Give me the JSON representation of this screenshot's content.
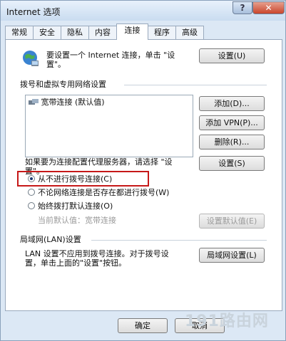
{
  "window": {
    "title": "Internet 选项",
    "help": "?",
    "close": "✕"
  },
  "tabs": [
    {
      "label": "常规"
    },
    {
      "label": "安全"
    },
    {
      "label": "隐私"
    },
    {
      "label": "内容"
    },
    {
      "label": "连接"
    },
    {
      "label": "程序"
    },
    {
      "label": "高级"
    }
  ],
  "setup": {
    "text_line1": "要设置一个 Internet 连接，单击 \"设",
    "text_line2": "置\"。",
    "button": "设置(U)"
  },
  "dialup": {
    "header": "拨号和虚拟专用网络设置",
    "list_item": "宽带连接 (默认值)",
    "add": "添加(D)...",
    "add_vpn": "添加 VPN(P)...",
    "remove": "删除(R)...",
    "settings": "设置(S)",
    "proxy_text_line1": "如果要为连接配置代理服务器，请选择 \"设",
    "proxy_text_line2": "置\"。",
    "radio1": "从不进行拨号连接(C)",
    "radio2": "不论网络连接是否存在都进行拨号(W)",
    "radio3": "始终拨打默认连接(O)",
    "current_default": "当前默认值：宽带连接",
    "set_default": "设置默认值(E)"
  },
  "lan": {
    "header": "局域网(LAN)设置",
    "text_line1": "LAN 设置不应用到拨号连接。对于拨号设",
    "text_line2": "置，单击上面的\"设置\"按钮。",
    "button": "局域网设置(L)"
  },
  "footer": {
    "ok": "确定",
    "cancel": "取消"
  },
  "watermark": "191路由网"
}
